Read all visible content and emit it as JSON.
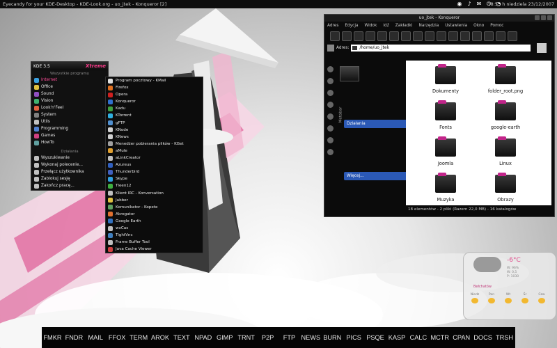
{
  "topbar": {
    "title": "Eyecandy for your KDE-Desktop - KDE-Look.org - uo_jtek - Konqueror [2]",
    "clock": "18:55 h niedziela 23/12/2007",
    "tray_icons": [
      "network-icon",
      "volume-icon",
      "mail-icon",
      "system-icon",
      "pacman-icon"
    ]
  },
  "kmenu": {
    "version": "KDE 3.5",
    "brand": "Xtreme",
    "section_programs": "Wszystkie programy",
    "programs": [
      {
        "label": "Internet",
        "color": "#3aa0e0",
        "selected": true
      },
      {
        "label": "Office",
        "color": "#e0c040"
      },
      {
        "label": "Sound",
        "color": "#9050c0"
      },
      {
        "label": "Vision",
        "color": "#40b070"
      },
      {
        "label": "Look'n'Feel",
        "color": "#e06040"
      },
      {
        "label": "System",
        "color": "#808080"
      },
      {
        "label": "Utils",
        "color": "#c0c0c0"
      },
      {
        "label": "Programming",
        "color": "#5080d0"
      },
      {
        "label": "Games",
        "color": "#d04080"
      },
      {
        "label": "HowTo",
        "color": "#60a0a0"
      }
    ],
    "section_actions": "Działania",
    "actions": [
      {
        "label": "Wyszukiwanie",
        "color": "#c0c0c0"
      },
      {
        "label": "Wykonaj polecenie...",
        "color": "#c0c0c0"
      },
      {
        "label": "Przełącz użytkownika",
        "color": "#c0c0c0"
      },
      {
        "label": "Zablokuj sesję",
        "color": "#c0c0c0"
      },
      {
        "label": "Zakończ pracę...",
        "color": "#c0c0c0"
      }
    ]
  },
  "submenu": {
    "items": [
      {
        "label": "Program pocztowy - KMail",
        "color": "#e0e0e0"
      },
      {
        "label": "Firefox",
        "color": "#e07020"
      },
      {
        "label": "Opera",
        "color": "#d02020"
      },
      {
        "label": "Konqueror",
        "color": "#3070d0"
      },
      {
        "label": "Kadu",
        "color": "#40a040"
      },
      {
        "label": "KTorrent",
        "color": "#30b0e0"
      },
      {
        "label": "gFTP",
        "color": "#5090d0"
      },
      {
        "label": "KNode",
        "color": "#d0d0d0"
      },
      {
        "label": "KNews",
        "color": "#d0d0d0"
      },
      {
        "label": "Menedżer pobierania plików - KGet",
        "color": "#a0a0a0"
      },
      {
        "label": "aMule",
        "color": "#e0a030"
      },
      {
        "label": "aLinkCreator",
        "color": "#c0c0c0"
      },
      {
        "label": "Azureus",
        "color": "#3060c0"
      },
      {
        "label": "Thunderbird",
        "color": "#4060c0"
      },
      {
        "label": "Skype",
        "color": "#30a0e0"
      },
      {
        "label": "Tleen12",
        "color": "#40b040"
      },
      {
        "label": "Klient IRC - Konversation",
        "color": "#c0c0c0"
      },
      {
        "label": "Jabber",
        "color": "#e0c040"
      },
      {
        "label": "Komunikator - Kopete",
        "color": "#60a060"
      },
      {
        "label": "Akregator",
        "color": "#e07030"
      },
      {
        "label": "Google Earth",
        "color": "#3070c0"
      },
      {
        "label": "wxCas",
        "color": "#c0c0c0"
      },
      {
        "label": "TightVnc",
        "color": "#4080c0"
      },
      {
        "label": "Frame Buffer Tool",
        "color": "#c0c0c0"
      },
      {
        "label": "Java Cache Viewer",
        "color": "#d04040"
      }
    ]
  },
  "konqueror": {
    "title": "uo_jtek - Konqueror",
    "menu": [
      "Adres",
      "Edycja",
      "Widok",
      "Idź",
      "Zakładki",
      "Narzędzia",
      "Ustawienia",
      "Okno",
      "Pomoc"
    ],
    "location_label": "Adres:",
    "location_value": "/home/uo_jtek",
    "metabar_label": "Metabar",
    "metabar_actions": "Działania",
    "metabar_more": "Więcej...",
    "files": [
      "Dokumenty",
      "folder_root.png",
      "Fonts",
      "google-earth",
      "Joomla",
      "Linux",
      "Muzyka",
      "Obrazy"
    ],
    "status": "18 elementów - 2 pliki (Razem 22,0 MB) - 16 katalogów"
  },
  "weather": {
    "temperature": "-6°C",
    "location": "Bełchatów",
    "stats": [
      "W: 96%",
      "W: 0,5",
      "P: 1030"
    ],
    "days": [
      "Niedz",
      "Pon",
      "Wt",
      "Śr",
      "Czw"
    ]
  },
  "dock": {
    "items": [
      "FMKR",
      "FNDR",
      "MAIL",
      "FFOX",
      "TERM",
      "AROK",
      "TEXT",
      "NPAD",
      "GIMP",
      "TRNT",
      "P2P",
      "FTP",
      "NEWS",
      "BURN",
      "PICS",
      "PSQE",
      "KASP",
      "CALC",
      "MCTR",
      "CPAN",
      "DOCS",
      "TRSH"
    ]
  }
}
